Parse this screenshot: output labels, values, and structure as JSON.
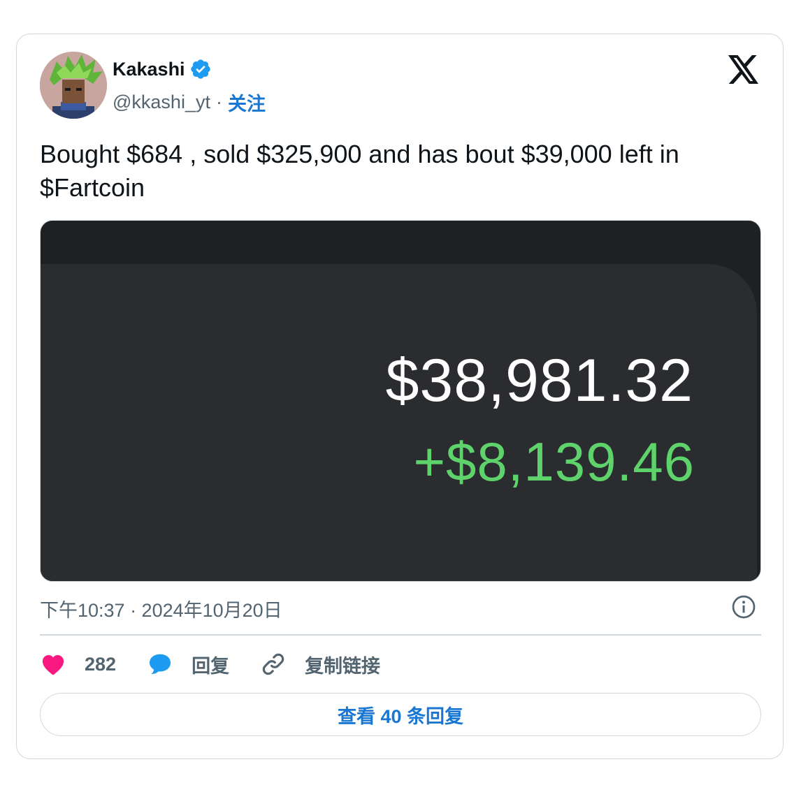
{
  "author": {
    "name": "Kakashi",
    "handle": "@kkashi_yt",
    "separator": "·",
    "follow_label": "关注"
  },
  "tweet": {
    "text": "Bought $684 , sold $325,900 and has bout $39,000 left in $Fartcoin"
  },
  "media": {
    "balance": "$38,981.32",
    "change": "+$8,139.46",
    "change_color": "#5fd36b"
  },
  "meta": {
    "timestamp": "下午10:37 · 2024年10月20日"
  },
  "actions": {
    "likes_count": "282",
    "reply_label": "回复",
    "copy_link_label": "复制链接"
  },
  "footer": {
    "view_replies_label": "查看 40 条回复"
  },
  "colors": {
    "accent": "#1877d2",
    "like": "#f91880",
    "reply_icon": "#1d9bf0",
    "verified": "#1d9bf0"
  },
  "icons": [
    "x-logo-icon",
    "verified-badge-icon",
    "info-icon",
    "heart-icon",
    "reply-bubble-icon",
    "link-icon"
  ]
}
